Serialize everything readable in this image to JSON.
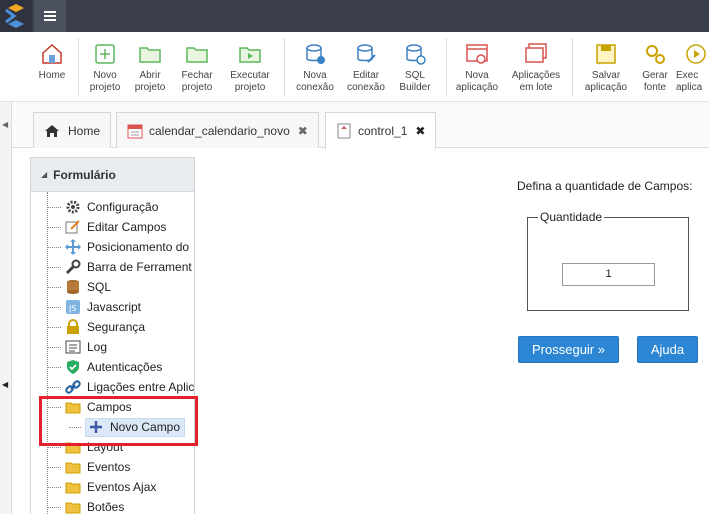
{
  "toolbar": {
    "items": [
      {
        "label": "Home",
        "icon": "home-icon"
      },
      {
        "label": "Novo\nprojeto",
        "icon": "new-project-icon"
      },
      {
        "label": "Abrir\nprojeto",
        "icon": "open-project-icon"
      },
      {
        "label": "Fechar\nprojeto",
        "icon": "close-project-icon"
      },
      {
        "label": "Executar\nprojeto",
        "icon": "run-project-icon"
      },
      {
        "label": "Nova\nconexão",
        "icon": "new-connection-icon"
      },
      {
        "label": "Editar\nconexão",
        "icon": "edit-connection-icon"
      },
      {
        "label": "SQL\nBuilder",
        "icon": "sql-builder-icon"
      },
      {
        "label": "Nova\naplicação",
        "icon": "new-app-icon"
      },
      {
        "label": "Aplicações\nem lote",
        "icon": "batch-apps-icon"
      },
      {
        "label": "Salvar\naplicação",
        "icon": "save-app-icon"
      },
      {
        "label": "Gerar\nfonte",
        "icon": "generate-source-icon"
      },
      {
        "label": "Exec\naplica",
        "icon": "run-app-icon"
      }
    ]
  },
  "tabs": [
    {
      "label": "Home",
      "icon": "home-icon"
    },
    {
      "label": "calendar_calendario_novo",
      "icon": "calendar-icon",
      "close": "✖"
    },
    {
      "label": "control_1",
      "icon": "form-icon",
      "close": "✖"
    }
  ],
  "panel": {
    "title": "Formulário",
    "items": [
      {
        "label": "Configuração",
        "icon": "gear-icon"
      },
      {
        "label": "Editar Campos",
        "icon": "edit-fields-icon"
      },
      {
        "label": "Posicionamento do",
        "icon": "move-icon"
      },
      {
        "label": "Barra de Ferrament",
        "icon": "wrench-icon"
      },
      {
        "label": "SQL",
        "icon": "database-icon"
      },
      {
        "label": "Javascript",
        "icon": "javascript-icon"
      },
      {
        "label": "Segurança",
        "icon": "lock-icon"
      },
      {
        "label": "Log",
        "icon": "log-icon"
      },
      {
        "label": "Autenticações",
        "icon": "shield-check-icon"
      },
      {
        "label": "Ligações entre Aplic",
        "icon": "link-icon"
      },
      {
        "label": "Campos",
        "icon": "folder-icon"
      },
      {
        "label": "Novo Campo",
        "icon": "plus-icon"
      },
      {
        "label": "Layout",
        "icon": "folder-icon"
      },
      {
        "label": "Eventos",
        "icon": "folder-icon"
      },
      {
        "label": "Eventos Ajax",
        "icon": "folder-icon"
      },
      {
        "label": "Botões",
        "icon": "folder-icon"
      }
    ]
  },
  "form": {
    "prompt": "Defina a quantidade de Campos:",
    "legend": "Quantidade",
    "quantity_value": "1",
    "proceed_label": "Prosseguir »",
    "help_label": "Ajuda"
  },
  "colors": {
    "topbar": "#3a3f4b",
    "button": "#2d86d3",
    "highlight": "#e3202b",
    "selected": "#dbe8f7"
  }
}
